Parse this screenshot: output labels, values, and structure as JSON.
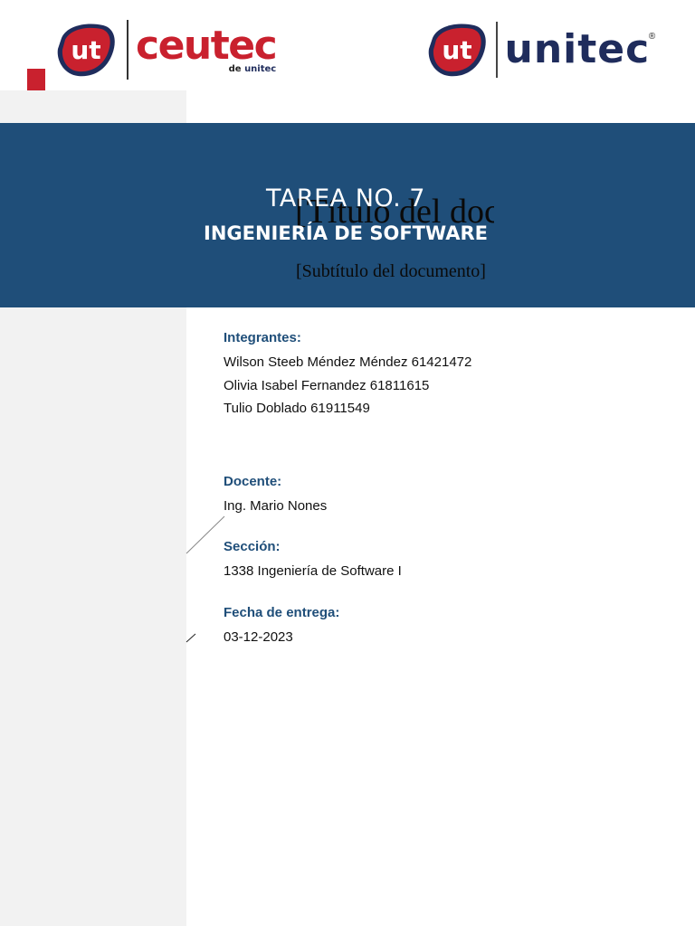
{
  "colors": {
    "navy": "#1f2c5c",
    "red": "#c9212e",
    "banner_blue": "#1f4e79"
  },
  "logos": {
    "ceutec": {
      "badge_text": "ut",
      "word": "ceutec",
      "sub_prefix": "de",
      "sub_brand": "unitec"
    },
    "unitec": {
      "badge_text": "ut",
      "word": "unitec",
      "registered_mark": "®"
    }
  },
  "banner": {
    "task_title": "TAREA NO. 7",
    "course_title": "INGENIERÍA DE SOFTWARE",
    "doc_title_placeholder": "[Título del documento]",
    "doc_subtitle_placeholder": "[Subtítulo del documento]"
  },
  "info": {
    "integrantes": {
      "label": "Integrantes:",
      "members": [
        "Wilson Steeb Méndez Méndez 61421472",
        "Olivia Isabel Fernandez 61811615",
        "Tulio Doblado 61911549"
      ]
    },
    "docente": {
      "label": "Docente:",
      "value": "Ing. Mario Nones"
    },
    "seccion": {
      "label": "Sección:",
      "value": "1338 Ingeniería de Software I"
    },
    "fecha": {
      "label": "Fecha de entrega:",
      "value": "03-12-2023"
    }
  }
}
